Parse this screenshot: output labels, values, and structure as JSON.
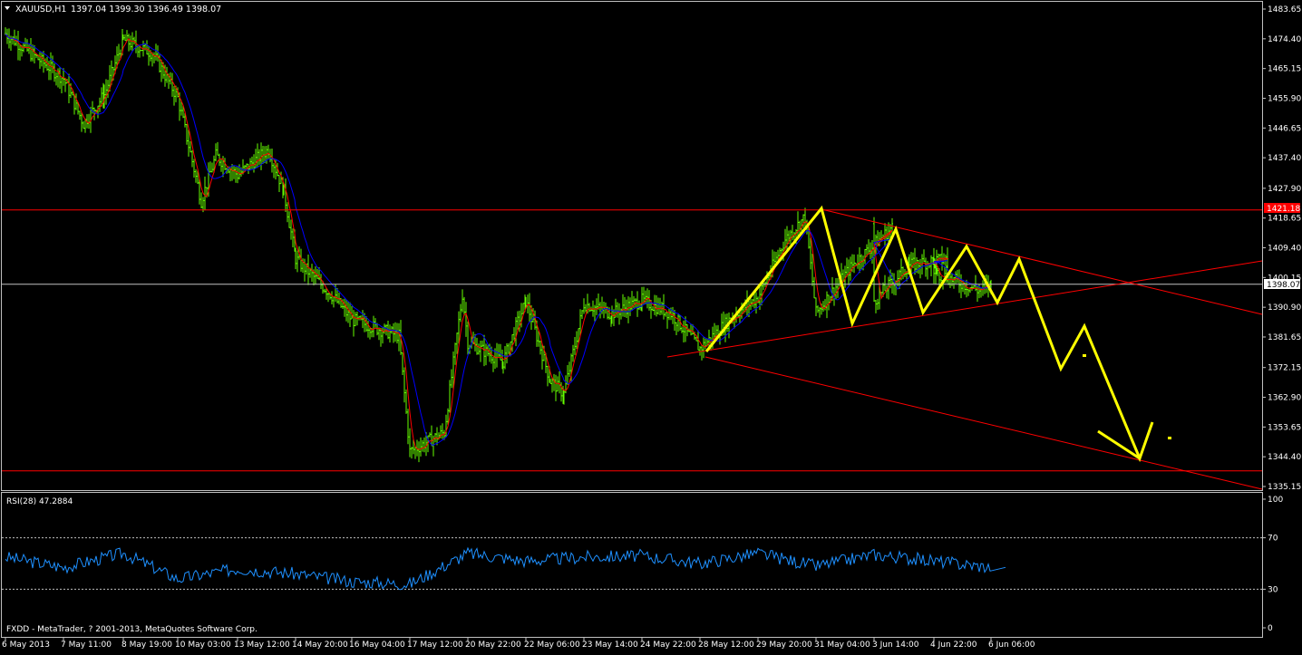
{
  "window": {
    "symbol_label": "XAUUSD,H1",
    "ohlc_label": "1397.04 1399.30 1396.49 1398.07",
    "footer": "FXDD - MetaTrader, ? 2001-2013, MetaQuotes Software Corp."
  },
  "colors": {
    "background": "#000000",
    "frame": "#c0c0c0",
    "candles": "#66ff00",
    "ma_fast": "#ff0000",
    "ma_slow": "#0000ff",
    "level_lines": "#ff0000",
    "current_price_line": "#c0c0c0",
    "pattern": "#ffff00",
    "rsi_line": "#1e90ff",
    "price_tag_bg": "#ff0000",
    "text": "#ffffff"
  },
  "chart_data": [
    {
      "type": "candlestick",
      "title": "XAUUSD,H1",
      "timeframe": "H1",
      "ylim": [
        1335.15,
        1483.65
      ],
      "y_ticks": [
        "1483.65",
        "1474.40",
        "1465.15",
        "1455.90",
        "1446.65",
        "1437.40",
        "1427.90",
        "1418.65",
        "1409.40",
        "1400.15",
        "1390.90",
        "1381.65",
        "1372.15",
        "1362.90",
        "1353.65",
        "1344.40",
        "1335.15"
      ],
      "x_ticks": [
        "6 May 2013",
        "7 May 11:00",
        "8 May 19:00",
        "10 May 03:00",
        "13 May 12:00",
        "14 May 20:00",
        "16 May 04:00",
        "17 May 12:00",
        "20 May 22:00",
        "22 May 06:00",
        "23 May 14:00",
        "24 May 22:00",
        "28 May 12:00",
        "29 May 20:00",
        "31 May 04:00",
        "3 Jun 14:00",
        "4 Jun 22:00",
        "6 Jun 06:00"
      ],
      "current_price": 1398.07,
      "current_price_label": "1398.07",
      "horizontal_levels": [
        {
          "value": 1421.18,
          "label": "1421.18"
        },
        {
          "value": 1340.0,
          "label": ""
        }
      ],
      "moving_averages": [
        "fast (red)",
        "slow (blue)"
      ],
      "price_path": [
        {
          "x": "6 May 2013",
          "y": 1476
        },
        {
          "x": "7 May 11:00",
          "y": 1462
        },
        {
          "x": "7 May 20:00",
          "y": 1448
        },
        {
          "x": "8 May 09:00",
          "y": 1457
        },
        {
          "x": "8 May 19:00",
          "y": 1474
        },
        {
          "x": "9 May 12:00",
          "y": 1470
        },
        {
          "x": "10 May 03:00",
          "y": 1456
        },
        {
          "x": "10 May 14:00",
          "y": 1424
        },
        {
          "x": "11 May 00:00",
          "y": 1438
        },
        {
          "x": "13 May 12:00",
          "y": 1432
        },
        {
          "x": "13 May 22:00",
          "y": 1440
        },
        {
          "x": "14 May 09:00",
          "y": 1427
        },
        {
          "x": "14 May 20:00",
          "y": 1406
        },
        {
          "x": "15 May 12:00",
          "y": 1394
        },
        {
          "x": "16 May 04:00",
          "y": 1387
        },
        {
          "x": "16 May 20:00",
          "y": 1382
        },
        {
          "x": "17 May 12:00",
          "y": 1346
        },
        {
          "x": "17 May 20:00",
          "y": 1352
        },
        {
          "x": "20 May 10:00",
          "y": 1395
        },
        {
          "x": "20 May 22:00",
          "y": 1380
        },
        {
          "x": "21 May 14:00",
          "y": 1374
        },
        {
          "x": "22 May 06:00",
          "y": 1393
        },
        {
          "x": "22 May 15:00",
          "y": 1368
        },
        {
          "x": "23 May 02:00",
          "y": 1364
        },
        {
          "x": "23 May 14:00",
          "y": 1392
        },
        {
          "x": "24 May 06:00",
          "y": 1389
        },
        {
          "x": "24 May 22:00",
          "y": 1393
        },
        {
          "x": "27 May 12:00",
          "y": 1389
        },
        {
          "x": "28 May 12:00",
          "y": 1378
        },
        {
          "x": "29 May 06:00",
          "y": 1388
        },
        {
          "x": "29 May 20:00",
          "y": 1394
        },
        {
          "x": "30 May 14:00",
          "y": 1412
        },
        {
          "x": "30 May 22:00",
          "y": 1419
        },
        {
          "x": "31 May 04:00",
          "y": 1389
        },
        {
          "x": "31 May 20:00",
          "y": 1404
        },
        {
          "x": "3 Jun 05:00",
          "y": 1416
        },
        {
          "x": "3 Jun 14:00",
          "y": 1393
        },
        {
          "x": "3 Jun 22:00",
          "y": 1404
        },
        {
          "x": "4 Jun 10:00",
          "y": 1406
        },
        {
          "x": "4 Jun 22:00",
          "y": 1402
        },
        {
          "x": "5 Jun 14:00",
          "y": 1396
        },
        {
          "x": "6 Jun 06:00",
          "y": 1398
        }
      ]
    },
    {
      "type": "line",
      "title": "RSI(28) 47.2884",
      "indicator": "RSI(28)",
      "value_label": "47.2884",
      "ylim": [
        0,
        100
      ],
      "y_ticks": [
        "100",
        "70",
        "30",
        "0"
      ],
      "levels": [
        70,
        30
      ],
      "series": [
        {
          "x": "6 May 2013",
          "y": 55
        },
        {
          "x": "7 May 11:00",
          "y": 47
        },
        {
          "x": "8 May 19:00",
          "y": 58
        },
        {
          "x": "10 May 03:00",
          "y": 38
        },
        {
          "x": "13 May 12:00",
          "y": 46
        },
        {
          "x": "14 May 20:00",
          "y": 42
        },
        {
          "x": "16 May 04:00",
          "y": 36
        },
        {
          "x": "17 May 12:00",
          "y": 34
        },
        {
          "x": "20 May 22:00",
          "y": 58
        },
        {
          "x": "22 May 06:00",
          "y": 52
        },
        {
          "x": "23 May 14:00",
          "y": 55
        },
        {
          "x": "24 May 22:00",
          "y": 56
        },
        {
          "x": "28 May 12:00",
          "y": 50
        },
        {
          "x": "29 May 20:00",
          "y": 58
        },
        {
          "x": "31 May 04:00",
          "y": 48
        },
        {
          "x": "3 Jun 14:00",
          "y": 57
        },
        {
          "x": "4 Jun 22:00",
          "y": 52
        },
        {
          "x": "6 Jun 06:00",
          "y": 47
        }
      ]
    }
  ]
}
